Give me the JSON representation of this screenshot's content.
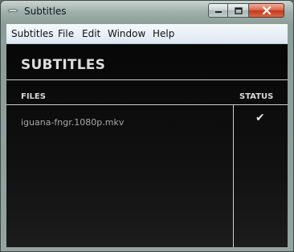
{
  "window": {
    "title": "Subtitles",
    "controls": {
      "minimize": "minimize-icon",
      "maximize": "maximize-icon",
      "close": "close-icon"
    }
  },
  "menu": {
    "items": [
      {
        "label": "Subtitles"
      },
      {
        "label": "File"
      },
      {
        "label": "Edit"
      },
      {
        "label": "Window"
      },
      {
        "label": "Help"
      }
    ]
  },
  "main": {
    "heading": "SUBTITLES",
    "columns": {
      "files": "FILES",
      "status": "STATUS"
    },
    "rows": [
      {
        "file": "iguana-fngr.1080p.mkv",
        "status": "✔",
        "status_icon": "checkmark-icon"
      }
    ]
  },
  "colors": {
    "content_bg": "#0d0d0d",
    "divider": "#cfcfcf",
    "close_button": "#c4371b",
    "menu_bg": "#e8eef6"
  }
}
